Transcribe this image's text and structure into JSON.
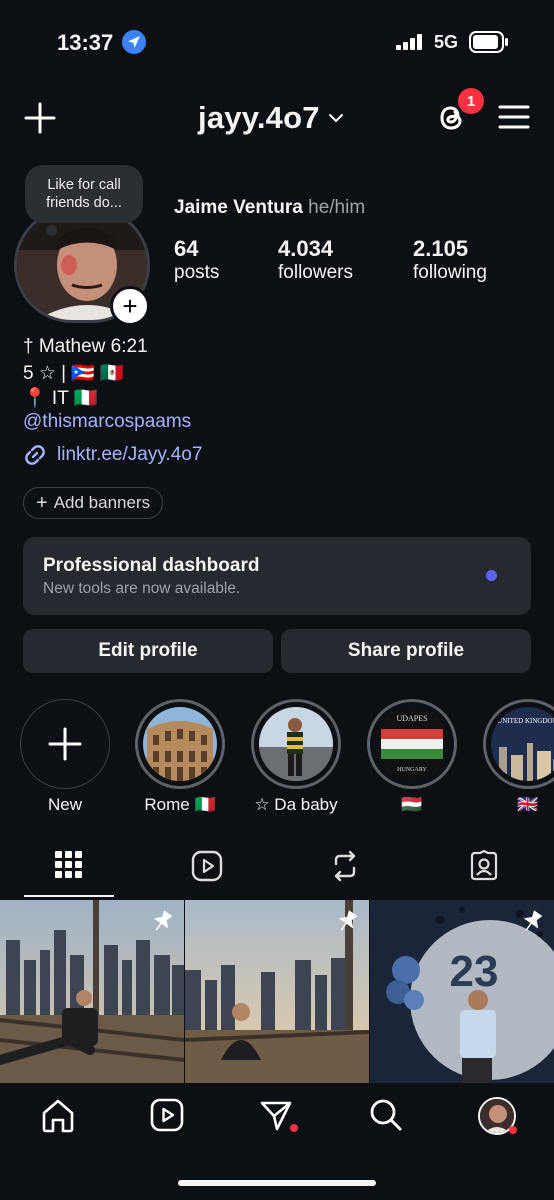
{
  "status_bar": {
    "time": "13:37",
    "network": "5G"
  },
  "header": {
    "username": "jayy.4o7",
    "threads_badge": "1"
  },
  "profile": {
    "note": "Like for call friends do...",
    "full_name": "Jaime Ventura",
    "pronouns": "he/him",
    "stats": [
      {
        "value": "64",
        "label": "posts"
      },
      {
        "value": "4.034",
        "label": "followers"
      },
      {
        "value": "2.105",
        "label": "following"
      }
    ],
    "bio_lines": [
      "† Mathew 6:21",
      "5 ☆ | 🇵🇷 🇲🇽",
      "📍 IT 🇮🇹"
    ],
    "mention": "@thismarcospaams",
    "link": "linktr.ee/Jayy.4o7",
    "add_banners": "Add banners"
  },
  "dashboard": {
    "title": "Professional dashboard",
    "subtitle": "New tools are now available."
  },
  "buttons": {
    "edit": "Edit profile",
    "share": "Share profile"
  },
  "highlights": [
    {
      "label": "New"
    },
    {
      "label": "Rome 🇮🇹"
    },
    {
      "label": "☆ Da baby"
    },
    {
      "label": "🇭🇺"
    },
    {
      "label": "🇬🇧"
    }
  ],
  "highlight_texts": {
    "hungary_top": "UDAPES",
    "hungary_bottom": "HUNGARY",
    "uk_top": "UNITED KINGDOM"
  },
  "tabs": [
    "grid-icon",
    "reels-icon",
    "reposts-icon",
    "tagged-icon"
  ],
  "posts": [
    {
      "pinned": true,
      "badge_text": ""
    },
    {
      "pinned": true,
      "badge_text": ""
    },
    {
      "pinned": true,
      "badge_text": "23"
    }
  ],
  "nav": [
    "home-icon",
    "reels-icon",
    "send-icon",
    "search-icon",
    "profile-avatar"
  ],
  "colors": {
    "background": "#0c0f14",
    "accent_link": "#a5b4fc",
    "badge": "#ff3040",
    "dashboard_dot": "#5865f2"
  }
}
